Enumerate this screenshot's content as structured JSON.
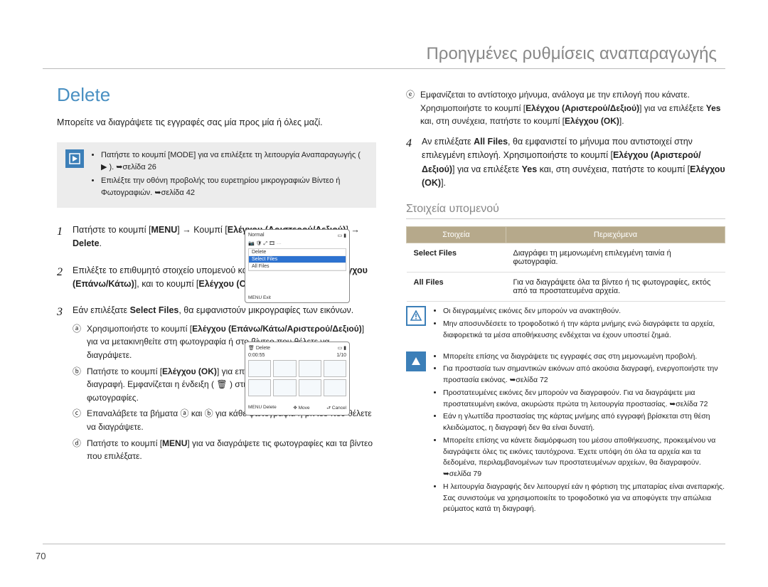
{
  "page_number": "70",
  "header_title": "Προηγμένες ρυθμίσεις αναπαραγωγής",
  "section_title": "Delete",
  "intro": "Μπορείτε να διαγράψετε τις εγγραφές σας μία προς μία ή όλες μαζί.",
  "topnote": {
    "items": [
      "Πατήστε το κουμπί [MODE] για να επιλέξετε τη λειτουργία Αναπαραγωγής ( ▶ ). ➥σελίδα 26",
      "Επιλέξτε την οθόνη προβολής του ευρετηρίου μικρογραφιών Βίντεο ή Φωτογραφιών. ➥σελίδα 42"
    ]
  },
  "steps": [
    {
      "html": "Πατήστε το κουμπί [<b>MENU</b>] <span class='arrow'>→</span> Κουμπί [<b>Ελέγχου (Αριστερού/Δεξιού)</b>] <span class='arrow'>→</span> <b>Delete</b>."
    },
    {
      "html": "Επιλέξτε το επιθυμητό στοιχείο υπομενού και μενού με το κουμπί [<b>Ελέγχου (Επάνω/Κάτω)</b>], και το κουμπί [<b>Ελέγχου (OK)</b>]."
    },
    {
      "html": "Εάν επιλέξατε <b>Select Files</b>, θα εμφανιστούν μικρογραφίες των εικόνων.",
      "sub": [
        {
          "mark": "ⓐ",
          "html": "Χρησιμοποιήστε το κουμπί [<b>Ελέγχου (Επάνω/Κάτω/Αριστερού/Δεξιού)</b>] για να μετακινηθείτε στη φωτογραφία ή στο βίντεο που θέλετε να διαγράψετε."
        },
        {
          "mark": "ⓑ",
          "html": "Πατήστε το κουμπί [<b>Ελέγχου (OK)</b>] για επισήμανση των εικόνων για διαγραφή. Εμφανίζεται η ένδειξη ( 🗑 ) στις επιλεγμένες ταινίες ή φωτογραφίες."
        },
        {
          "mark": "ⓒ",
          "html": "Επαναλάβετε τα βήματα ⓐ και ⓑ για κάθε φωτογραφία ή βίντεο που θέλετε να διαγράψετε."
        },
        {
          "mark": "ⓓ",
          "html": "Πατήστε το κουμπί [<b>MENU</b>] για να διαγράψετε τις φωτογραφίες και τα βίντεο που επιλέξατε."
        }
      ]
    }
  ],
  "right_lead": {
    "mark": "ⓔ",
    "html": "Εμφανίζεται το αντίστοιχο μήνυμα, ανάλογα με την επιλογή που κάνατε. Χρησιμοποιήστε το κουμπί [<b>Ελέγχου (Αριστερού/Δεξιού)</b>] για να επιλέξετε <b>Yes</b> και, στη συνέχεια, πατήστε το κουμπί [<b>Ελέγχου (OK)</b>]."
  },
  "step4": {
    "html": "Αν επιλέξατε <b>All Files</b>, θα εμφανιστεί το μήνυμα που αντιστοιχεί στην επιλεγμένη επιλογή. Χρησιμοποιήστε το κουμπί [<b>Ελέγχου (Αριστερού/Δεξιού)</b>] για να επιλέξετε <b>Yes</b> και, στη συνέχεια, πατήστε το κουμπί [<b>Ελέγχου (OK)</b>]."
  },
  "submenu_heading": "Στοιχεία υπομενού",
  "table": {
    "head": [
      "Στοιχεία",
      "Περιεχόμενα"
    ],
    "rows": [
      {
        "k": "Select Files",
        "v": "Διαγράφει τη μεμονωμένη επιλεγμένη ταινία ή φωτογραφία."
      },
      {
        "k": "All Files",
        "v": "Για να διαγράψετε όλα τα βίντεο ή τις φωτογραφίες, εκτός από τα προστατευμένα αρχεία."
      }
    ]
  },
  "warn": [
    "Οι διεγραμμένες εικόνες δεν μπορούν να ανακτηθούν.",
    "Μην αποσυνδέσετε το τροφοδοτικό ή την κάρτα μνήμης ενώ διαγράφετε τα αρχεία, διαφορετικά τα μέσα αποθήκευσης ενδέχεται να έχουν υποστεί ζημιά."
  ],
  "info": [
    "Μπορείτε επίσης να διαγράψετε τις εγγραφές σας στη μεμονωμένη προβολή.",
    "Για προστασία των σημαντικών εικόνων από ακούσια διαγραφή, ενεργοποιήστε την προστασία εικόνας. ➥σελίδα 72",
    "Προστατευμένες εικόνες δεν μπορούν να διαγραφούν. Για να διαγράψετε μια προστατευμένη εικόνα, ακυρώστε πρώτα τη λειτουργία προστασίας. ➥σελίδα 72",
    "Εάν η γλωττίδα προστασίας της κάρτας μνήμης από εγγραφή βρίσκεται στη θέση κλειδώματος, η διαγραφή δεν θα είναι δυνατή.",
    "Μπορείτε επίσης να κάνετε διαμόρφωση του μέσου αποθήκευσης, προκειμένου να διαγράψετε όλες τις εικόνες ταυτόχρονα. Έχετε υπόψη ότι όλα τα αρχεία και τα δεδομένα, περιλαμβανομένων των προστατευμένων αρχείων, θα διαγραφούν. ➥σελίδα 79",
    "Η λειτουργία διαγραφής δεν λειτουργεί εάν η φόρτιση της μπαταρίας είναι ανεπαρκής. Σας συνιστούμε να χρησιμοποιείτε το τροφοδοτικό για να αποφύγετε την απώλεια ρεύματος κατά τη διαγραφή."
  ],
  "shot1": {
    "title": "Normal",
    "items": [
      "Delete",
      "Select Files",
      "All Files"
    ],
    "selected": 1,
    "footL": "MENU Exit"
  },
  "shot2": {
    "title": "Delete",
    "time": "0:00:55",
    "count": "1/10",
    "footL": "MENU Delete",
    "footM": "✥ Move",
    "footR": "⮐ Cancel"
  }
}
